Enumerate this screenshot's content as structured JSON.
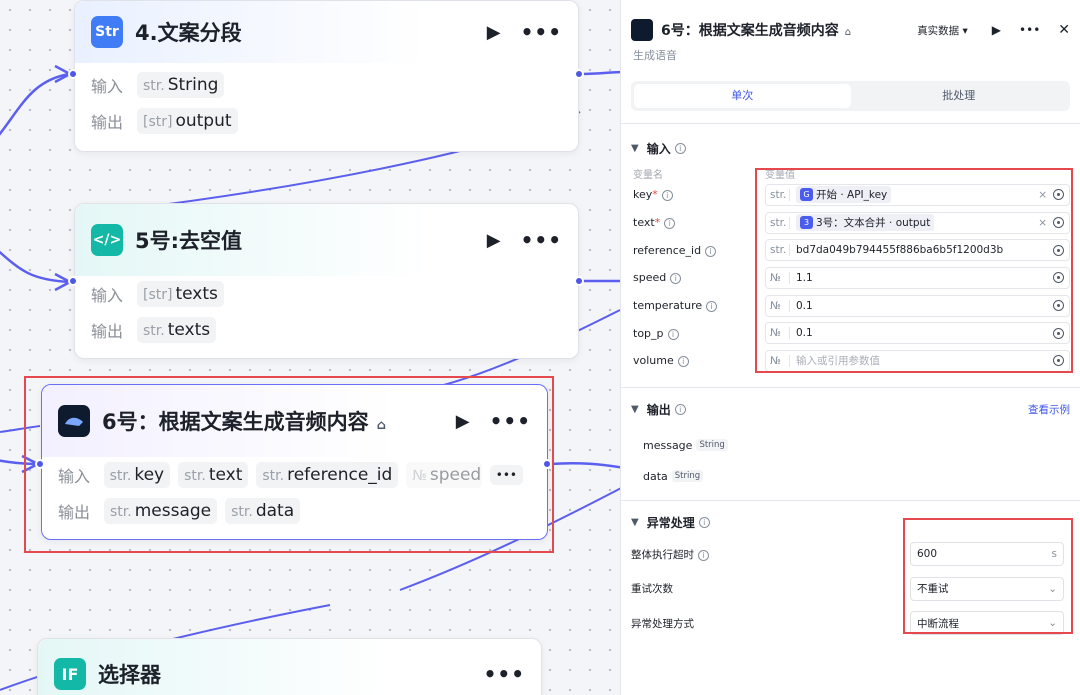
{
  "canvas": {
    "node4": {
      "title": "4.文案分段",
      "icon_text": "Str",
      "in_label": "输入",
      "out_label": "输出",
      "input": {
        "type": "str.",
        "name": "String"
      },
      "output": {
        "type": "[str]",
        "name": "output"
      }
    },
    "node5": {
      "title": "5号:去空值",
      "icon_text": "</>",
      "in_label": "输入",
      "out_label": "输出",
      "input": {
        "type": "[str]",
        "name": "texts"
      },
      "output": {
        "type": "str.",
        "name": "texts"
      }
    },
    "node6": {
      "title": "6号：根据文案生成音频内容",
      "in_label": "输入",
      "out_label": "输出",
      "inputs": [
        {
          "type": "str.",
          "name": "key"
        },
        {
          "type": "str.",
          "name": "text"
        },
        {
          "type": "str.",
          "name": "reference_id"
        },
        {
          "type": "№",
          "name": "speed"
        }
      ],
      "outputs": [
        {
          "type": "str.",
          "name": "message"
        },
        {
          "type": "str.",
          "name": "data"
        }
      ]
    },
    "node7": {
      "title": "选择器",
      "icon_text": "IF"
    }
  },
  "panel": {
    "title": "6号：根据文案生成音频内容",
    "mode": "真实数据",
    "subtitle": "生成语音",
    "tabs": [
      "单次",
      "批处理"
    ],
    "input_section": "输入",
    "col_name": "变量名",
    "col_value": "变量值",
    "params": [
      {
        "name": "key",
        "required": true,
        "type": "str.",
        "kind": "ref",
        "ref_icon": "G",
        "value": "开始 · API_key"
      },
      {
        "name": "text",
        "required": true,
        "type": "str.",
        "kind": "ref",
        "ref_icon": "3",
        "value": "3号：文本合并 · output"
      },
      {
        "name": "reference_id",
        "required": false,
        "type": "str.",
        "kind": "text",
        "value": "bd7da049b794455f886ba6b5f1200d3b"
      },
      {
        "name": "speed",
        "required": false,
        "type": "№",
        "kind": "text",
        "value": "1.1"
      },
      {
        "name": "temperature",
        "required": false,
        "type": "№",
        "kind": "text",
        "value": "0.1"
      },
      {
        "name": "top_p",
        "required": false,
        "type": "№",
        "kind": "text",
        "value": "0.1"
      },
      {
        "name": "volume",
        "required": false,
        "type": "№",
        "kind": "placeholder",
        "value": "输入或引用参数值"
      }
    ],
    "output_section": "输出",
    "view_example": "查看示例",
    "outputs": [
      {
        "name": "message",
        "type": "String"
      },
      {
        "name": "data",
        "type": "String"
      }
    ],
    "error_section": "异常处理",
    "timeout_label": "整体执行超时",
    "timeout_value": "600",
    "timeout_unit": "s",
    "retry_label": "重试次数",
    "retry_value": "不重试",
    "handling_label": "异常处理方式",
    "handling_value": "中断流程"
  }
}
